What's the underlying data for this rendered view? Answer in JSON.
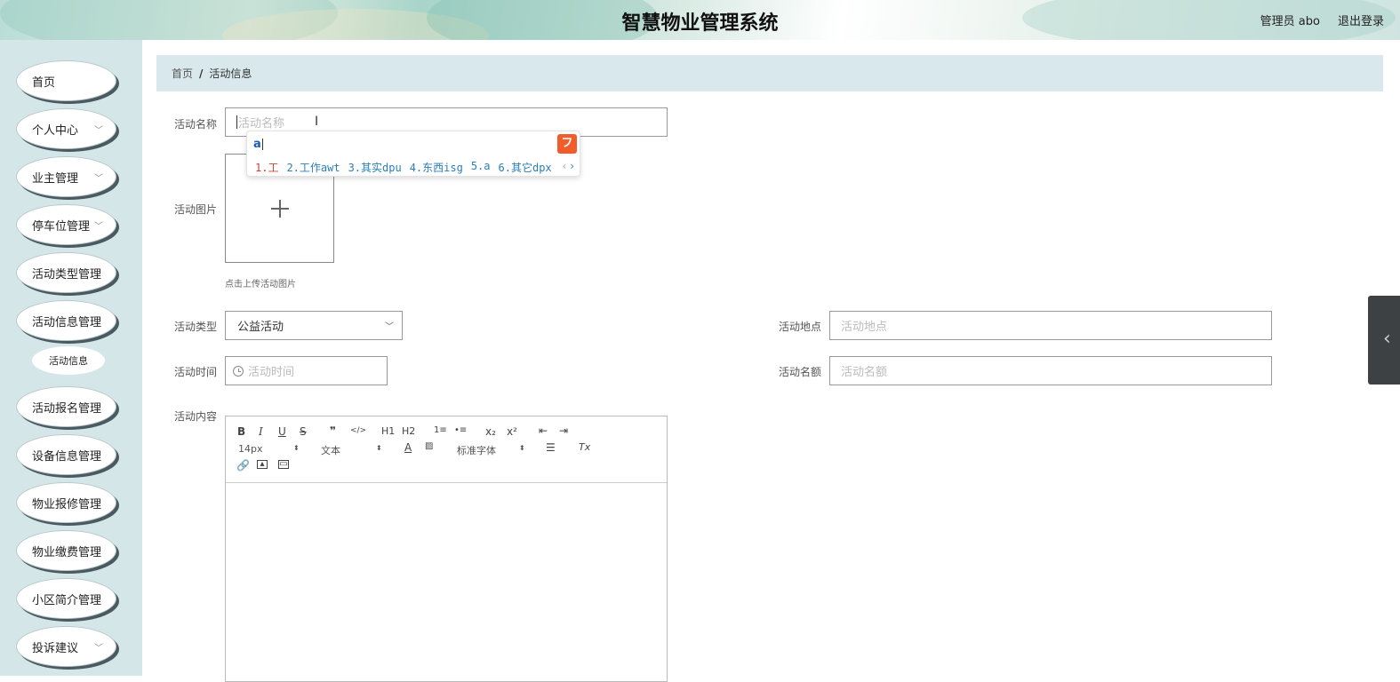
{
  "header": {
    "title": "智慧物业管理系统",
    "user": "管理员 abo",
    "logout": "退出登录"
  },
  "sidebar": {
    "items": [
      {
        "label": "首页",
        "has_chevron": false
      },
      {
        "label": "个人中心",
        "has_chevron": true
      },
      {
        "label": "业主管理",
        "has_chevron": true
      },
      {
        "label": "停车位管理",
        "has_chevron": true
      },
      {
        "label": "活动类型管理",
        "has_chevron": false
      },
      {
        "label": "活动信息管理",
        "has_chevron": false
      },
      {
        "label": "活动报名管理",
        "has_chevron": false
      },
      {
        "label": "设备信息管理",
        "has_chevron": false
      },
      {
        "label": "物业报修管理",
        "has_chevron": false
      },
      {
        "label": "物业缴费管理",
        "has_chevron": false
      },
      {
        "label": "小区简介管理",
        "has_chevron": false
      },
      {
        "label": "投诉建议",
        "has_chevron": true
      }
    ],
    "sub_item": "活动信息"
  },
  "breadcrumb": {
    "home": "首页",
    "separator": "/",
    "current": "活动信息"
  },
  "form": {
    "name_label": "活动名称",
    "name_placeholder": "活动名称",
    "image_label": "活动图片",
    "image_tip": "点击上传活动图片",
    "type_label": "活动类型",
    "type_value": "公益活动",
    "location_label": "活动地点",
    "location_placeholder": "活动地点",
    "time_label": "活动时间",
    "time_placeholder": "活动时间",
    "quota_label": "活动名额",
    "quota_placeholder": "活动名额",
    "content_label": "活动内容"
  },
  "ime": {
    "composition": "a",
    "logo": "フ",
    "candidates": [
      "1.工",
      "2.工作awt",
      "3.其实dpu",
      "4.东西isg",
      "5.a",
      "6.其它dpx"
    ],
    "prev": "‹",
    "next": "›"
  },
  "editor": {
    "buttons": [
      "B",
      "I",
      "U",
      "S",
      "❞",
      "</>",
      "H1",
      "H2",
      "1≡",
      "•≡",
      "x₂",
      "x²",
      "⇤",
      "⇥"
    ],
    "font_size": "14px",
    "block_type": "文本",
    "font_family": "标准字体",
    "text_color": "A",
    "clear_format": "Tx"
  },
  "side_tab": {
    "icon": "‹"
  }
}
